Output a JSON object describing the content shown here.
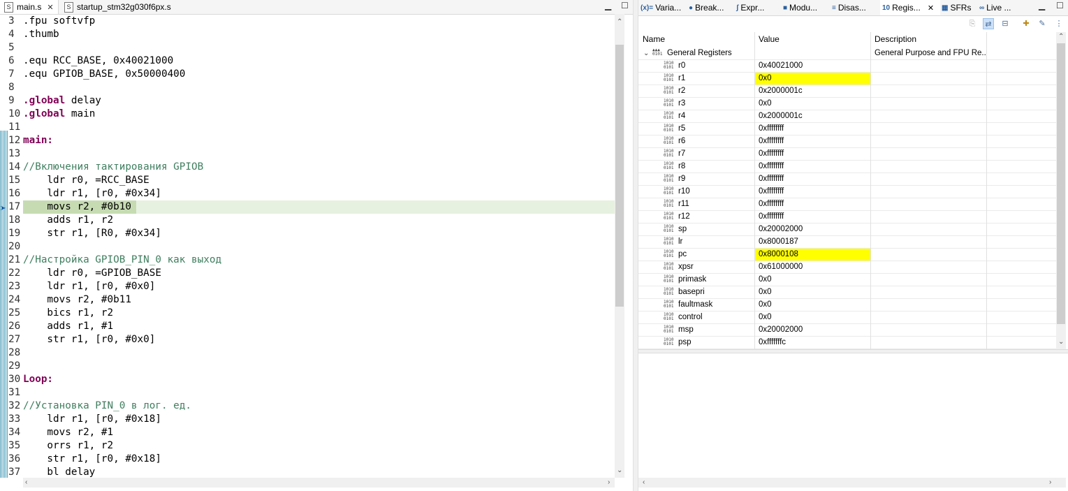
{
  "editor": {
    "tabs": [
      {
        "label": "main.s",
        "icon": "asm-file-icon",
        "active": true
      },
      {
        "label": "startup_stm32g030f6px.s",
        "icon": "asm-file-icon",
        "active": false
      }
    ],
    "lines": [
      {
        "n": "3",
        "segs": [
          {
            "t": ".fpu softvfp",
            "c": ""
          }
        ]
      },
      {
        "n": "4",
        "segs": [
          {
            "t": ".thumb",
            "c": ""
          }
        ]
      },
      {
        "n": "5",
        "segs": []
      },
      {
        "n": "6",
        "segs": [
          {
            "t": ".equ RCC_BASE, 0x40021000",
            "c": ""
          }
        ]
      },
      {
        "n": "7",
        "segs": [
          {
            "t": ".equ GPIOB_BASE, 0x50000400",
            "c": ""
          }
        ]
      },
      {
        "n": "8",
        "segs": []
      },
      {
        "n": "9",
        "segs": [
          {
            "t": ".global",
            "c": "kw"
          },
          {
            "t": " delay",
            "c": ""
          }
        ]
      },
      {
        "n": "10",
        "segs": [
          {
            "t": ".global",
            "c": "kw"
          },
          {
            "t": " main",
            "c": ""
          }
        ]
      },
      {
        "n": "11",
        "segs": []
      },
      {
        "n": "12",
        "segs": [
          {
            "t": "main:",
            "c": "kw"
          }
        ]
      },
      {
        "n": "13",
        "segs": []
      },
      {
        "n": "14",
        "segs": [
          {
            "t": "//Включения тактирования GPIOB",
            "c": "cm"
          }
        ]
      },
      {
        "n": "15",
        "segs": [
          {
            "t": "    ldr r0, =RCC_BASE",
            "c": ""
          }
        ]
      },
      {
        "n": "16",
        "segs": [
          {
            "t": "    ldr r1, [r0, #0x34]",
            "c": ""
          }
        ]
      },
      {
        "n": "17",
        "segs": [
          {
            "t": "    movs r2, #0b10",
            "c": ""
          }
        ],
        "current": true
      },
      {
        "n": "18",
        "segs": [
          {
            "t": "    adds r1, r2",
            "c": ""
          }
        ]
      },
      {
        "n": "19",
        "segs": [
          {
            "t": "    str r1, [R0, #0x34]",
            "c": ""
          }
        ]
      },
      {
        "n": "20",
        "segs": []
      },
      {
        "n": "21",
        "segs": [
          {
            "t": "//Настройка GPIOB_PIN_0 как выход",
            "c": "cm"
          }
        ]
      },
      {
        "n": "22",
        "segs": [
          {
            "t": "    ldr r0, =GPIOB_BASE",
            "c": ""
          }
        ]
      },
      {
        "n": "23",
        "segs": [
          {
            "t": "    ldr r1, [r0, #0x0]",
            "c": ""
          }
        ]
      },
      {
        "n": "24",
        "segs": [
          {
            "t": "    movs r2, #0b11",
            "c": ""
          }
        ]
      },
      {
        "n": "25",
        "segs": [
          {
            "t": "    bics r1, r2",
            "c": ""
          }
        ]
      },
      {
        "n": "26",
        "segs": [
          {
            "t": "    adds r1, #1",
            "c": ""
          }
        ]
      },
      {
        "n": "27",
        "segs": [
          {
            "t": "    str r1, [r0, #0x0]",
            "c": ""
          }
        ]
      },
      {
        "n": "28",
        "segs": []
      },
      {
        "n": "29",
        "segs": []
      },
      {
        "n": "30",
        "segs": [
          {
            "t": "Loop:",
            "c": "kw"
          }
        ]
      },
      {
        "n": "31",
        "segs": []
      },
      {
        "n": "32",
        "segs": [
          {
            "t": "//Установка PIN_0 в лог. ед.",
            "c": "cm"
          }
        ]
      },
      {
        "n": "33",
        "segs": [
          {
            "t": "    ldr r1, [r0, #0x18]",
            "c": ""
          }
        ]
      },
      {
        "n": "34",
        "segs": [
          {
            "t": "    movs r2, #1",
            "c": ""
          }
        ]
      },
      {
        "n": "35",
        "segs": [
          {
            "t": "    orrs r1, r2",
            "c": ""
          }
        ]
      },
      {
        "n": "36",
        "segs": [
          {
            "t": "    str r1, [r0, #0x18]",
            "c": ""
          }
        ]
      },
      {
        "n": "37",
        "segs": [
          {
            "t": "    bl delay",
            "c": ""
          }
        ]
      }
    ],
    "colors": {
      "keyword": "#7f0055",
      "comment": "#3f7f5f",
      "current_line": "#c6dbb2"
    }
  },
  "right": {
    "tabs": [
      {
        "label": "Varia...",
        "icon": "(x)="
      },
      {
        "label": "Break...",
        "icon": "●"
      },
      {
        "label": "Expr...",
        "icon": "ʃ"
      },
      {
        "label": "Modu...",
        "icon": "■"
      },
      {
        "label": "Disas...",
        "icon": "≡"
      },
      {
        "label": "Regis...",
        "icon": "10",
        "active": true
      },
      {
        "label": "SFRs",
        "icon": "▦"
      },
      {
        "label": "Live ...",
        "icon": "∞"
      }
    ],
    "columns": {
      "name": "Name",
      "value": "Value",
      "description": "Description"
    },
    "group": {
      "name": "General Registers",
      "description": "General Purpose and FPU Re..."
    },
    "registers": [
      {
        "name": "r0",
        "value": "0x40021000"
      },
      {
        "name": "r1",
        "value": "0x0",
        "changed": true
      },
      {
        "name": "r2",
        "value": "0x2000001c"
      },
      {
        "name": "r3",
        "value": "0x0"
      },
      {
        "name": "r4",
        "value": "0x2000001c"
      },
      {
        "name": "r5",
        "value": "0xffffffff"
      },
      {
        "name": "r6",
        "value": "0xffffffff"
      },
      {
        "name": "r7",
        "value": "0xffffffff"
      },
      {
        "name": "r8",
        "value": "0xffffffff"
      },
      {
        "name": "r9",
        "value": "0xffffffff"
      },
      {
        "name": "r10",
        "value": "0xffffffff"
      },
      {
        "name": "r11",
        "value": "0xffffffff"
      },
      {
        "name": "r12",
        "value": "0xffffffff"
      },
      {
        "name": "sp",
        "value": "0x20002000"
      },
      {
        "name": "lr",
        "value": "0x8000187"
      },
      {
        "name": "pc",
        "value": "0x8000108",
        "changed": true
      },
      {
        "name": "xpsr",
        "value": "0x61000000"
      },
      {
        "name": "primask",
        "value": "0x0"
      },
      {
        "name": "basepri",
        "value": "0x0"
      },
      {
        "name": "faultmask",
        "value": "0x0"
      },
      {
        "name": "control",
        "value": "0x0"
      },
      {
        "name": "msp",
        "value": "0x20002000"
      },
      {
        "name": "psp",
        "value": "0xfffffffc"
      }
    ],
    "changed_color": "#ffff00"
  }
}
